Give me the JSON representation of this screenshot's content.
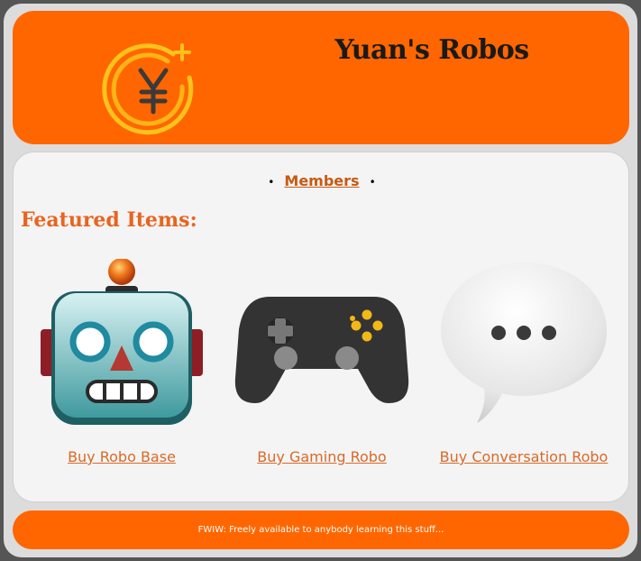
{
  "header": {
    "title": "Yuan's Robos",
    "logo_icon": "yuan-coin-icon"
  },
  "nav": {
    "members_label": "Members"
  },
  "featured": {
    "heading": "Featured Items:",
    "items": [
      {
        "icon": "robot-icon",
        "link_label": "Buy Robo Base"
      },
      {
        "icon": "game-controller-icon",
        "link_label": "Buy Gaming Robo"
      },
      {
        "icon": "speech-bubble-icon",
        "link_label": "Buy Conversation Robo"
      }
    ]
  },
  "footer": {
    "text": "FWIW: Freely available to anybody learning this stuff..."
  },
  "colors": {
    "brand_orange": "#ff6600",
    "link_orange": "#d86a28",
    "heading_orange": "#e8641f",
    "panel_bg": "#f4f4f4"
  }
}
